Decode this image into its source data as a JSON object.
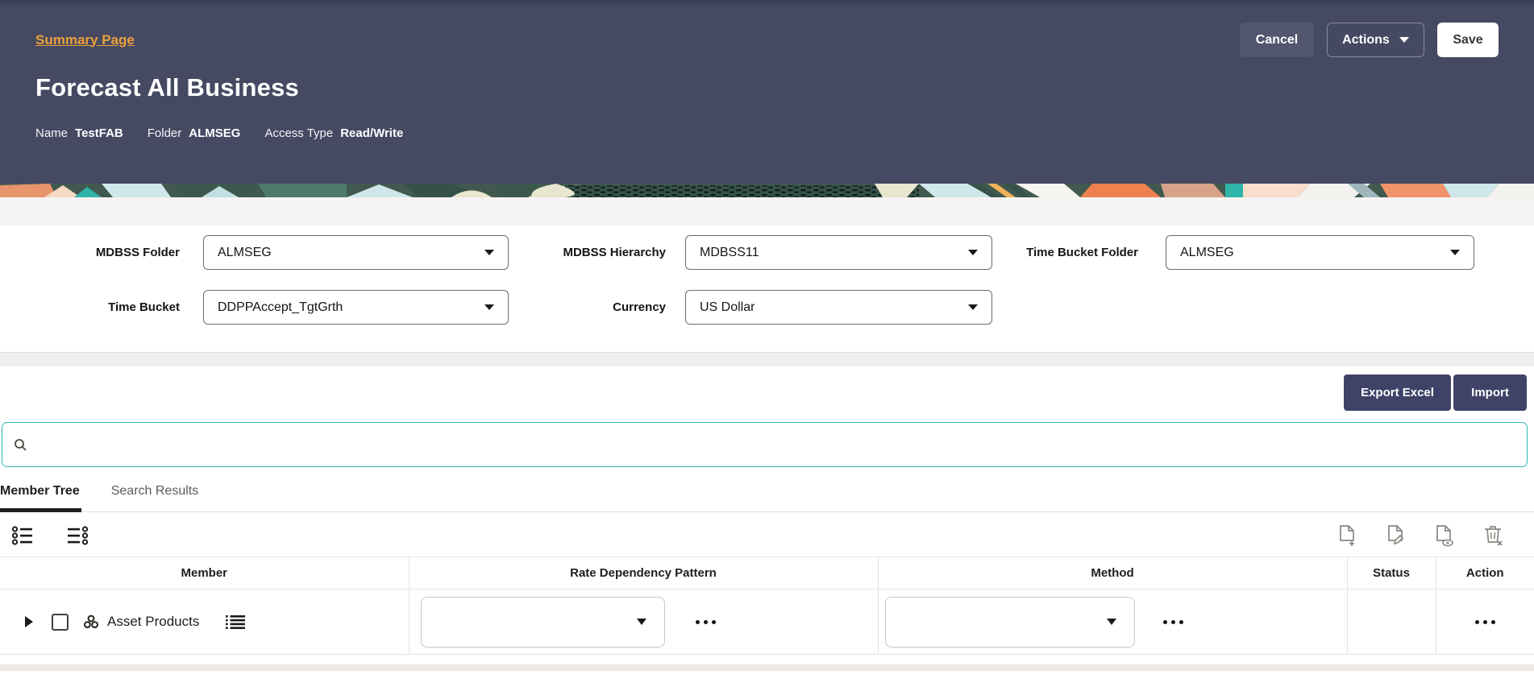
{
  "header": {
    "breadcrumb": "Summary Page",
    "title": "Forecast All Business",
    "meta": [
      {
        "label": "Name",
        "value": "TestFAB"
      },
      {
        "label": "Folder",
        "value": "ALMSEG"
      },
      {
        "label": "Access Type",
        "value": "Read/Write"
      }
    ],
    "buttons": {
      "cancel": "Cancel",
      "actions": "Actions",
      "save": "Save"
    }
  },
  "filters": {
    "fields": [
      {
        "label": "MDBSS Folder",
        "value": "ALMSEG"
      },
      {
        "label": "MDBSS Hierarchy",
        "value": "MDBSS11"
      },
      {
        "label": "Time Bucket Folder",
        "value": "ALMSEG"
      },
      {
        "label": "Time Bucket",
        "value": "DDPPAccept_TgtGrth"
      },
      {
        "label": "Currency",
        "value": "US Dollar"
      }
    ]
  },
  "actions_bar": {
    "export_label": "Export Excel",
    "import_label": "Import"
  },
  "search": {
    "placeholder": "",
    "value": ""
  },
  "tabs": [
    {
      "label": "Member Tree",
      "active": true
    },
    {
      "label": "Search Results",
      "active": false
    }
  ],
  "table": {
    "columns": [
      "Member",
      "Rate Dependency Pattern",
      "Method",
      "Status",
      "Action"
    ],
    "rows": [
      {
        "member": "Asset Products",
        "rate_dependency_pattern": "",
        "method": "",
        "status": ""
      }
    ]
  },
  "icons": {
    "search": "search-icon",
    "expand_all": "expand-tree-icon",
    "collapse_all": "collapse-tree-icon",
    "add_document": "document-add-icon",
    "edit_document": "document-edit-icon",
    "view_document": "document-view-icon",
    "delete": "trash-delete-icon",
    "hierarchy": "hierarchy-member-icon",
    "member_list": "member-list-icon",
    "more": "more-options-icon"
  },
  "colors": {
    "header_bg": "#454962",
    "link_gold": "#eca13c",
    "button_indigo": "#3f4368",
    "search_border_teal": "#2fb8ae",
    "page_bg": "#f5f4f2",
    "text_dark": "#161513",
    "icon_gray": "#8b8680"
  }
}
